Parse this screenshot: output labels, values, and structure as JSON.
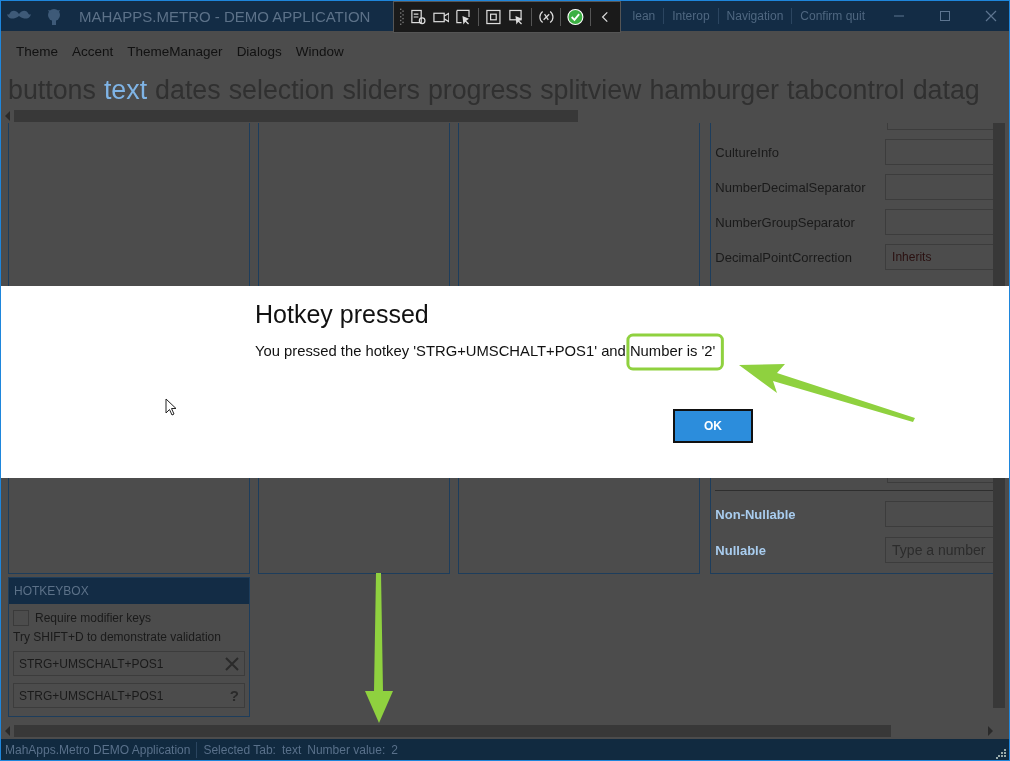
{
  "window": {
    "title": "MAHAPPS.METRO - DEMO APPLICATION",
    "commands": [
      "lean",
      "Interop",
      "Navigation",
      "Confirm quit"
    ]
  },
  "menu": [
    "Theme",
    "Accent",
    "ThemeManager",
    "Dialogs",
    "Window"
  ],
  "tabs": [
    {
      "label": "buttons",
      "selected": false
    },
    {
      "label": "text",
      "selected": true
    },
    {
      "label": "dates",
      "selected": false
    },
    {
      "label": "selection",
      "selected": false
    },
    {
      "label": "sliders",
      "selected": false
    },
    {
      "label": "progress",
      "selected": false
    },
    {
      "label": "splitview",
      "selected": false
    },
    {
      "label": "hamburger",
      "selected": false
    },
    {
      "label": "tabcontrol",
      "selected": false
    },
    {
      "label": "datag",
      "selected": false
    }
  ],
  "numeric_panel": {
    "rows": [
      {
        "label": "CultureInfo"
      },
      {
        "label": "NumberDecimalSeparator"
      },
      {
        "label": "NumberGroupSeparator"
      },
      {
        "label": "DecimalPointCorrection",
        "value": "Inherits"
      }
    ],
    "nullable_rows": [
      {
        "label": "Non-Nullable"
      },
      {
        "label": "Nullable",
        "placeholder": "Type a number"
      }
    ]
  },
  "hotkeybox": {
    "header": "HOTKEYBOX",
    "require_modifier": {
      "label": "Require modifier keys",
      "checked": false
    },
    "hint": "Try SHIFT+D to demonstrate validation",
    "fields": [
      {
        "value": "STRG+UMSCHALT+POS1",
        "kind": "clear"
      },
      {
        "value": "STRG+UMSCHALT+POS1",
        "kind": "help",
        "button": "?"
      }
    ]
  },
  "status_bar": {
    "app": "MahApps.Metro DEMO Application",
    "items": [
      "Selected Tab:",
      "text",
      "Number value:",
      "2"
    ]
  },
  "dialog": {
    "title": "Hotkey pressed",
    "message": "You pressed the hotkey 'STRG+UMSCHALT+POS1' and Number is '2'",
    "button": "OK"
  }
}
